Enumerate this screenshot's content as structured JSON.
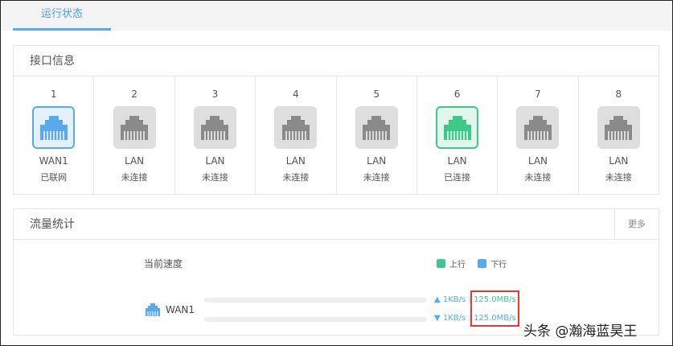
{
  "tabs": [
    {
      "label": "运行状态"
    }
  ],
  "interface_info": {
    "title": "接口信息",
    "ports": [
      {
        "num": "1",
        "type": "WAN1",
        "status": "已联网",
        "state": "wan"
      },
      {
        "num": "2",
        "type": "LAN",
        "status": "未连接",
        "state": "off"
      },
      {
        "num": "3",
        "type": "LAN",
        "status": "未连接",
        "state": "off"
      },
      {
        "num": "4",
        "type": "LAN",
        "status": "未连接",
        "state": "off"
      },
      {
        "num": "5",
        "type": "LAN",
        "status": "未连接",
        "state": "off"
      },
      {
        "num": "6",
        "type": "LAN",
        "status": "已连接",
        "state": "lanon"
      },
      {
        "num": "7",
        "type": "LAN",
        "status": "未连接",
        "state": "off"
      },
      {
        "num": "8",
        "type": "LAN",
        "status": "未连接",
        "state": "off"
      }
    ]
  },
  "traffic": {
    "title": "流量统计",
    "more": "更多",
    "current_speed": "当前速度",
    "legend": {
      "up": "上行",
      "down": "下行"
    },
    "wan": {
      "label": "WAN1",
      "up_speed": "1KB/s",
      "up_max": "125.0MB/s",
      "down_speed": "1KB/s",
      "down_max": "125.0MB/s"
    }
  },
  "colors": {
    "up": "#3ec98a",
    "down": "#5aa9ea",
    "highlight": "#e53935"
  },
  "watermark": "头条 @瀚海蓝昊王"
}
